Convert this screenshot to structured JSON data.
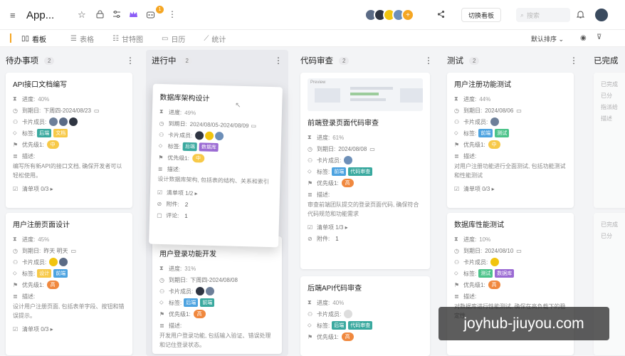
{
  "app": {
    "title": "App..."
  },
  "header": {
    "notif_count": "1",
    "switch_board": "切换看板",
    "search_placeholder": "搜索"
  },
  "views": [
    {
      "label": "看板",
      "icon": "board-icon"
    },
    {
      "label": "表格",
      "icon": "table-icon"
    },
    {
      "label": "甘特图",
      "icon": "gantt-icon"
    },
    {
      "label": "日历",
      "icon": "calendar-icon"
    },
    {
      "label": "统计",
      "icon": "stats-icon"
    }
  ],
  "sort": {
    "label": "默认排序"
  },
  "labels": {
    "progress": "进度:",
    "due": "到期日:",
    "members": "卡片成员:",
    "tags": "标签:",
    "priority": "优先级1:",
    "desc": "描述:",
    "checklist": "清单项",
    "attach": "附件:",
    "comment": "评论:"
  },
  "columns": [
    {
      "title": "待办事项",
      "count": "2"
    },
    {
      "title": "进行中",
      "count": "2"
    },
    {
      "title": "代码审查",
      "count": "2"
    },
    {
      "title": "测试",
      "count": "2"
    },
    {
      "title": "已完成",
      "count": ""
    }
  ],
  "cards": {
    "todo1": {
      "title": "API接口文档编写",
      "progress": "40%",
      "due": "下周四-2024/08/23",
      "tags": [
        "后端",
        "文档"
      ],
      "priority": "中",
      "desc": "编写所有新API的接口文档, 确保开发者可以轻松使用。",
      "checklist": "清单项 0/3 ▸"
    },
    "todo2": {
      "title": "用户注册页面设计",
      "progress": "45%",
      "due": "昨天 明天",
      "tags": [
        "设计",
        "前端"
      ],
      "priority": "高",
      "desc": "设计用户注册页面, 包括表单字段、按钮和错误提示。",
      "checklist": "清单项 0/3 ▸"
    },
    "prog1": {
      "title": "数据库架构设计",
      "progress": "49%",
      "due": "2024/08/05-2024/08/09",
      "tags": [
        "后端",
        "数据库"
      ],
      "priority": "中",
      "desc": "设计数据库架构, 包括表的结构、关系和索引",
      "checklist": "清单项 1/2 ▸",
      "attach": "2",
      "comment": "1"
    },
    "prog2": {
      "title": "用户登录功能开发",
      "progress": "31%",
      "due": "下周四-2024/08/08",
      "tags": [
        "后端",
        "前端"
      ],
      "priority": "高",
      "desc": "开发用户登录功能, 包括输入验证、错误处理和记住登录状态。"
    },
    "rev1": {
      "title": "前端登录页面代码审查",
      "progress": "61%",
      "due": "2024/08/08",
      "tags": [
        "前端",
        "代码审查"
      ],
      "priority": "高",
      "desc": "审查前端团队提交的登录页面代码, 确保符合代码规范和功能需求",
      "checklist": "清单项 1/3 ▸",
      "attach": "1",
      "preview_label": "Preview"
    },
    "rev2": {
      "title": "后端API代码审查",
      "progress": "40%",
      "tags": [
        "后端",
        "代码审查"
      ],
      "priority": "高"
    },
    "test1": {
      "title": "用户注册功能测试",
      "progress": "44%",
      "due": "2024/08/06",
      "tags": [
        "前端",
        "测试"
      ],
      "priority": "中",
      "desc": "对用户注册功能进行全面测试, 包括功能测试和性能测试",
      "checklist": "清单项 0/3 ▸"
    },
    "test2": {
      "title": "数据库性能测试",
      "progress": "10%",
      "due": "2024/08/10",
      "tags": [
        "测试",
        "数据库"
      ],
      "priority": "高",
      "desc": "对数据库进行性能测试, 确保在高负载下的稳定性"
    }
  },
  "done_ghost": {
    "r1": "已完成",
    "r2": "已分",
    "r3": "指派给",
    "r4": "描述"
  },
  "watermark": "joyhub-jiuyou.com",
  "colors": {
    "accent": "#f5a623",
    "tag_blue": "#4da3e0",
    "tag_green": "#4cc38a",
    "tag_yellow": "#f7c948",
    "tag_purple": "#9b6bd3",
    "tag_teal": "#3aa99f",
    "pri_mid": "#f7c948",
    "pri_high": "#f0883e"
  }
}
